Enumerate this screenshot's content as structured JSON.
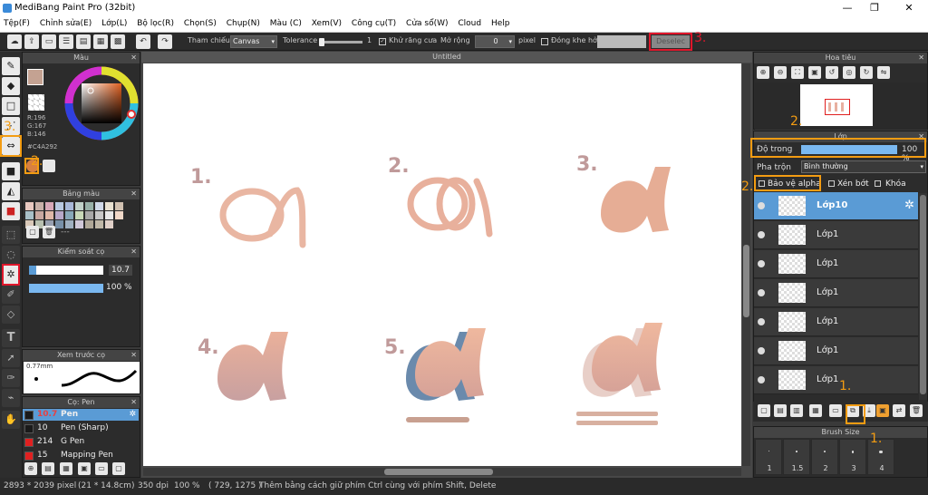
{
  "app": {
    "title": "MediBang Paint Pro (32bit)",
    "win_min": "—",
    "win_max": "❐",
    "win_close": "✕"
  },
  "menu": [
    "Tệp(F)",
    "Chỉnh sửa(E)",
    "Lớp(L)",
    "Bộ lọc(R)",
    "Chọn(S)",
    "Chụp(N)",
    "Màu (C)",
    "Xem(V)",
    "Công cụ(T)",
    "Cửa sổ(W)",
    "Cloud",
    "Help"
  ],
  "toolbar": {
    "tham_chieu_label": "Tham chiếu",
    "tham_chieu_value": "Canvas",
    "tolerance_label": "Tolerance",
    "tolerance_value": "1",
    "khu_rang_cua": "Khử răng cưa",
    "mo_rong_label": "Mở rộng",
    "mo_rong_value": "0",
    "pixel_label": "pixel",
    "dong_khe_ho_label": "Đóng khe hở",
    "deselect": "Deselec"
  },
  "color_panel": {
    "title": "Màu",
    "r": "R:196",
    "g": "G:167",
    "b": "B:146",
    "hex": "#C4A292",
    "foreground": "#c4a292"
  },
  "palette_panel": {
    "title": "Bảng màu",
    "dashes": "---",
    "colors": [
      "#e8c8c0",
      "#c8b0a8",
      "#d8a8b8",
      "#b8c8e0",
      "#a8b8d8",
      "#c0d0c8",
      "#98b0a8",
      "#d0d8e8",
      "#e8e0d0",
      "#d0c0b0",
      "#a8c0c8",
      "#c8a8a0",
      "#e0b8a8",
      "#b8a8c8",
      "#88a8b8",
      "#c8d8b8",
      "#a8a8a8",
      "#c8c8c8",
      "#e8e8e8",
      "#f0d8c8",
      "#d8c8b8",
      "#b8c0b0",
      "#98a0b0",
      "#7890a8",
      "#a0b0c0",
      "#d0c8d8",
      "#b0a898",
      "#c0b8a8",
      "#e0d0c8"
    ]
  },
  "brush_control": {
    "title": "Kiểm soát cọ",
    "size_value": "10.7",
    "opacity_value": "100 %",
    "size_fraction": 0.1,
    "opacity_fraction": 1.0
  },
  "brush_preview": {
    "title": "Xem trước cọ",
    "size": "0.77mm"
  },
  "brush_list": {
    "title": "Cọ: Pen",
    "items": [
      {
        "size": "10.7",
        "name": "Pen",
        "color": "#1a1a1a",
        "selected": true
      },
      {
        "size": "10",
        "name": "Pen (Sharp)",
        "color": "#1a1a1a",
        "selected": false
      },
      {
        "size": "214",
        "name": "G Pen",
        "color": "#e02020",
        "selected": false
      },
      {
        "size": "15",
        "name": "Mapping Pen",
        "color": "#e02020",
        "selected": false
      }
    ]
  },
  "canvas": {
    "tab": "Untitled",
    "labels": [
      "1.",
      "2.",
      "3.",
      "4.",
      "5."
    ]
  },
  "navigator": {
    "title": "Hoa tiêu"
  },
  "layer_panel": {
    "title": "Lớp",
    "opacity_label": "Độ trong",
    "opacity_value": "100 %",
    "blend_label": "Pha trộn",
    "blend_value": "Bình thường",
    "protect_alpha": "Bảo vệ alpha",
    "clip": "Xén bớt",
    "lock": "Khóa",
    "layers": [
      {
        "name": "Lớp10",
        "selected": true
      },
      {
        "name": "Lớp1",
        "selected": false
      },
      {
        "name": "Lớp1",
        "selected": false
      },
      {
        "name": "Lớp1",
        "selected": false
      },
      {
        "name": "Lớp1",
        "selected": false
      },
      {
        "name": "Lớp1",
        "selected": false
      },
      {
        "name": "Lớp1",
        "selected": false
      }
    ]
  },
  "brush_size": {
    "title": "Brush Size",
    "values": [
      "1",
      "1.5",
      "2",
      "3",
      "4"
    ]
  },
  "status": {
    "dimensions": "2893 * 2039 pixel",
    "physical": "(21 * 14.8cm)",
    "dpi": "350 dpi",
    "zoom": "100 %",
    "coords": "( 729, 1275 )",
    "hint": "Thêm bằng cách giữ phím Ctrl cùng với phím Shift, Delete"
  },
  "annotations": {
    "a1": "1.",
    "a2": "2.",
    "a3": "3.",
    "a4": "3.",
    "a5": "1.",
    "a6": "2.",
    "a7": "1.",
    "a8": "3."
  }
}
